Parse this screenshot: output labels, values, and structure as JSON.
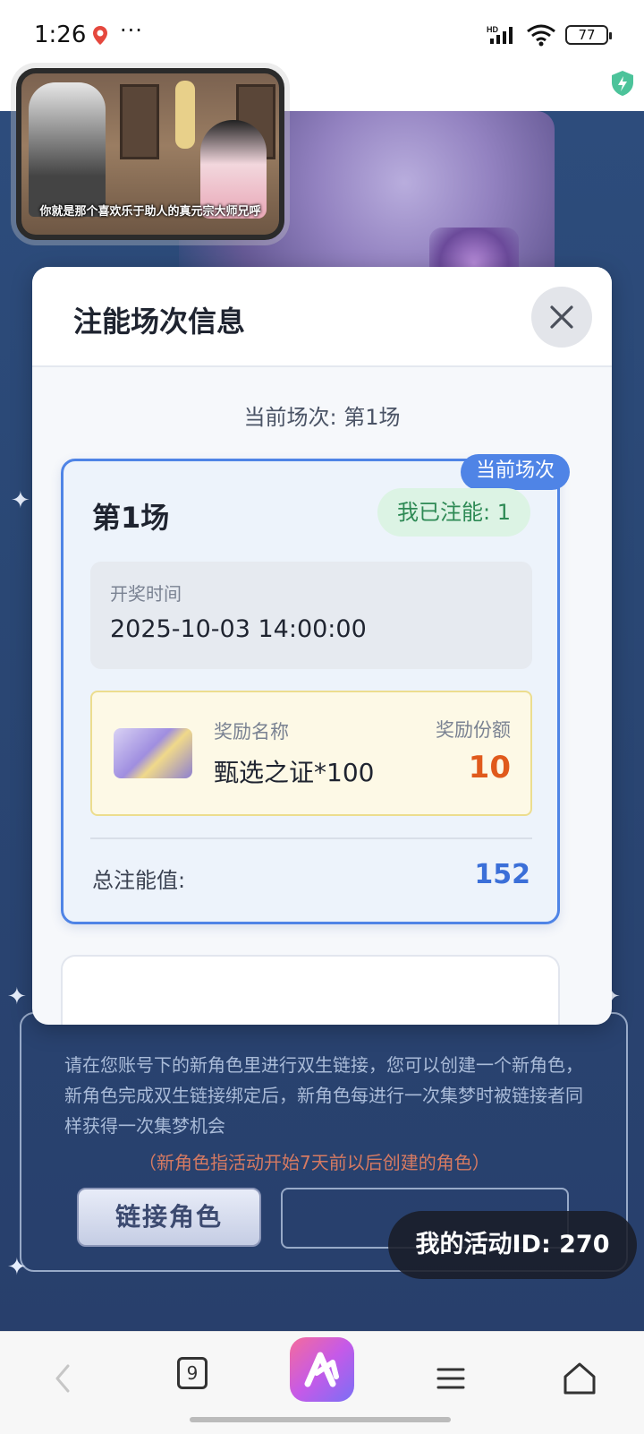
{
  "status_bar": {
    "time": "1:26",
    "more": "···",
    "battery": "77"
  },
  "video": {
    "subtitle": "你就是那个喜欢乐于助人的真元宗大师兄呼"
  },
  "modal": {
    "title": "注能场次信息",
    "current_session_text": "当前场次: 第1场",
    "card": {
      "tag": "当前场次",
      "title": "第1场",
      "energy_badge": "我已注能: 1",
      "draw_time_label": "开奖时间",
      "draw_time": "2025-10-03 14:00:00",
      "reward_name_label": "奖励名称",
      "reward_name": "甄选之证*100",
      "reward_share_label": "奖励份额",
      "reward_share": "10",
      "total_label": "总注能值:",
      "total_value": "152"
    }
  },
  "background_panel": {
    "description": "请在您账号下的新角色里进行双生链接，您可以创建一个新角色，新角色完成双生链接绑定后，新角色每进行一次集梦时被链接者同样获得一次集梦机会",
    "note": "（新角色指活动开始7天前以后创建的角色）",
    "link_button": "链接角色",
    "activity_id": "我的活动ID: 270"
  },
  "bottom_nav": {
    "tab_count": "9"
  },
  "colors": {
    "accent_blue": "#4f84e6",
    "reward_orange": "#e05a1c",
    "total_blue": "#3b6fd8",
    "badge_green": "#2e8a55"
  }
}
